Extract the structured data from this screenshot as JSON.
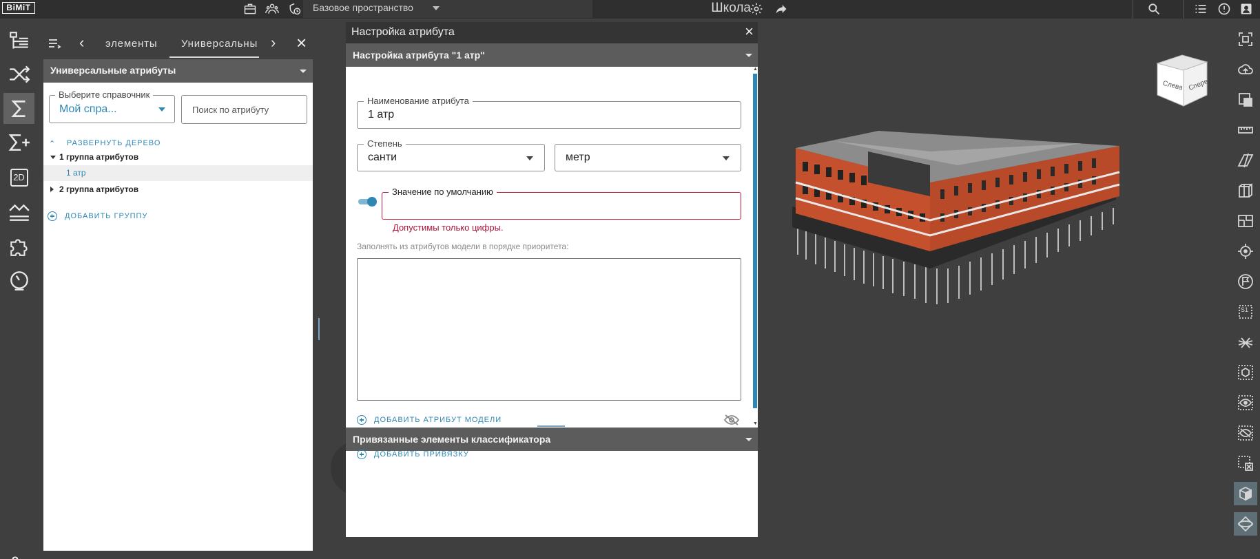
{
  "topbar": {
    "logo": "BiMiT",
    "space_select": "Базовое пространство",
    "project_title": "Школа"
  },
  "left_panel": {
    "tabs": [
      "элементы",
      "Универсальны"
    ],
    "section_title": "Универсальные атрибуты",
    "reference_select": {
      "label": "Выберите справочник",
      "value": "Мой спра..."
    },
    "search": {
      "placeholder": "Поиск по атрибуту"
    },
    "expand_tree": "РАЗВЕРНУТЬ ДЕРЕВО",
    "tree": [
      {
        "label": "1 группа атрибутов",
        "expanded": true
      },
      {
        "label": "1 атр",
        "selected": true
      },
      {
        "label": "2 группа атрибутов",
        "expanded": false
      }
    ],
    "add_group": "ДОБАВИТЬ ГРУППУ"
  },
  "rail": {
    "twod_label": "2D",
    "help": "?"
  },
  "navcube": {
    "left_face": "Слева",
    "front_face": "Спере"
  },
  "dialog": {
    "title": "Настройка атрибута",
    "section1_title": "Настройка атрибута \"1 атр\"",
    "name_field": {
      "label": "Наименование атрибута",
      "value": "1 атр"
    },
    "degree_field": {
      "label": "Степень",
      "value": "санти"
    },
    "unit_field": {
      "value": "метр"
    },
    "default_field": {
      "label": "Значение по умолчанию",
      "value": ""
    },
    "default_toggle_on": true,
    "error_text": "Допустимы только цифры.",
    "fill_hint": "Заполнять из атрибутов модели в порядке приоритета:",
    "add_model_attr": "ДОБАВИТЬ АТРИБУТ МОДЕЛИ",
    "section2_title": "Привязанные элементы классификатора",
    "add_link": "ДОБАВИТЬ ПРИВЯЗКУ"
  },
  "colors": {
    "accent": "#2e86b3",
    "error": "#c0133a",
    "header_bg": "#5c5c5c",
    "app_bg": "#3f3f3f"
  }
}
